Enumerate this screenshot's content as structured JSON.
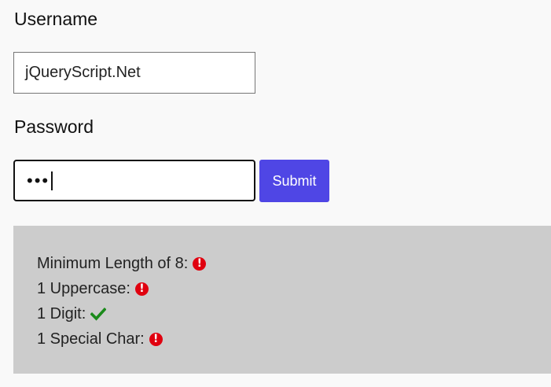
{
  "form": {
    "username_label": "Username",
    "username_value": "jQueryScript.Net",
    "password_label": "Password",
    "password_mask": "•••",
    "submit_label": "Submit"
  },
  "requirements": [
    {
      "text": "Minimum Length of 8:",
      "status": "fail",
      "icon": "exclamation-circle-icon",
      "color": "#e0000f"
    },
    {
      "text": "1 Uppercase:",
      "status": "fail",
      "icon": "exclamation-circle-icon",
      "color": "#e0000f"
    },
    {
      "text": "1 Digit:",
      "status": "pass",
      "icon": "check-icon",
      "color": "#1a8a1a"
    },
    {
      "text": "1 Special Char:",
      "status": "fail",
      "icon": "exclamation-circle-icon",
      "color": "#e0000f"
    }
  ],
  "colors": {
    "accent": "#4f46e5",
    "panel": "#cccccc",
    "error": "#e0000f",
    "success": "#1a8a1a"
  }
}
